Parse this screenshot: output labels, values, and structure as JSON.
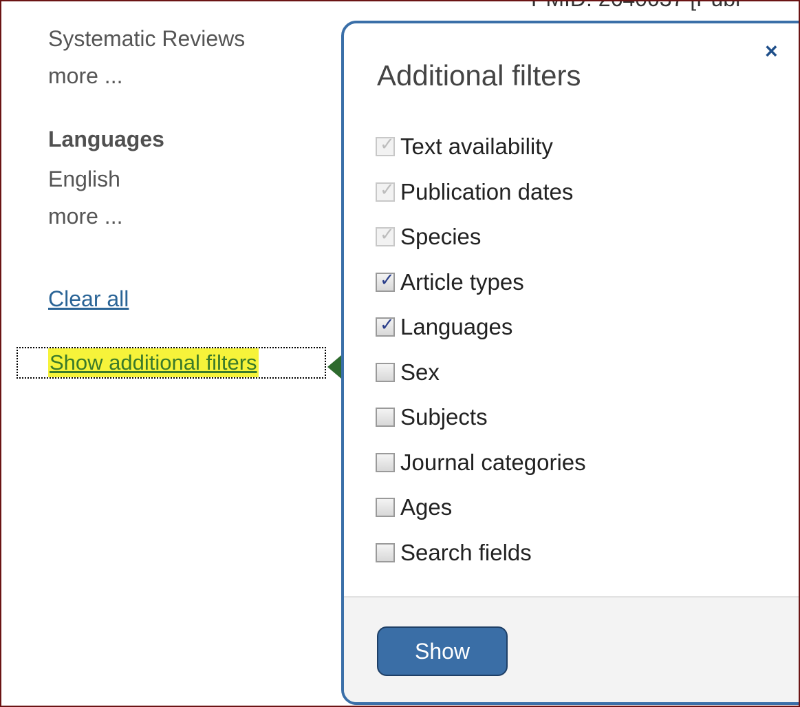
{
  "top_cut_text": "PMID: 2640037 [Publ",
  "sidebar": {
    "systematic_reviews": "Systematic Reviews",
    "more_1": "more ...",
    "languages_heading": "Languages",
    "english": "English",
    "more_2": "more ...",
    "clear_all": "Clear all",
    "show_additional_filters": "Show additional filters"
  },
  "popup": {
    "title": "Additional filters",
    "close_glyph": "×",
    "filters": [
      {
        "label": "Text availability",
        "state": "checked-disabled"
      },
      {
        "label": "Publication dates",
        "state": "checked-disabled"
      },
      {
        "label": "Species",
        "state": "checked-disabled"
      },
      {
        "label": "Article types",
        "state": "checked"
      },
      {
        "label": "Languages",
        "state": "checked"
      },
      {
        "label": "Sex",
        "state": "unchecked"
      },
      {
        "label": "Subjects",
        "state": "unchecked"
      },
      {
        "label": "Journal categories",
        "state": "unchecked"
      },
      {
        "label": "Ages",
        "state": "unchecked"
      },
      {
        "label": "Search fields",
        "state": "unchecked"
      }
    ],
    "show_button": "Show"
  },
  "colors": {
    "frame_border": "#6b1414",
    "popup_border": "#3a6fa8",
    "highlight": "#f6f33a",
    "arrow": "#2d6a2d",
    "button_bg": "#3a6ea6"
  }
}
